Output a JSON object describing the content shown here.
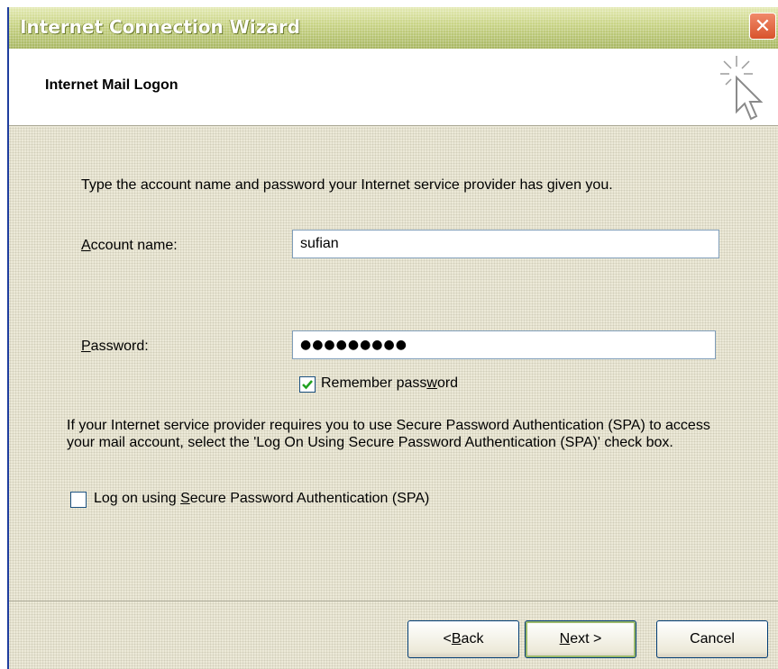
{
  "window": {
    "title": "Internet Connection Wizard",
    "close_symbol": "✕"
  },
  "header": {
    "title": "Internet Mail Logon",
    "icon": "wizard-cursor-icon"
  },
  "main": {
    "intro": "Type the account name and password your Internet service provider has given you.",
    "account_name": {
      "label_prefix": "",
      "label_accel": "A",
      "label_rest": "ccount name:",
      "value": "sufian"
    },
    "password": {
      "label_accel": "P",
      "label_rest": "assword:",
      "value": "●●●●●●●●●"
    },
    "remember_password": {
      "label_before": "Remember pass",
      "label_accel": "w",
      "label_after": "ord",
      "checked": true
    },
    "spa_info": "If your Internet service provider requires you to use Secure Password Authentication (SPA) to access your mail account, select the 'Log On Using Secure Password Authentication (SPA)' check box.",
    "spa_checkbox": {
      "label_before": "Log on using ",
      "label_accel": "S",
      "label_after": "ecure Password Authentication (SPA)",
      "checked": false
    }
  },
  "buttons": {
    "back_prefix": "< ",
    "back_accel": "B",
    "back_rest": "ack",
    "next_accel": "N",
    "next_rest": "ext >",
    "cancel": "Cancel"
  },
  "colors": {
    "titlebar": "#c9d486",
    "window_bg": "#ECE9D8",
    "check_mark": "#21a121",
    "close_button": "#d8532b"
  }
}
